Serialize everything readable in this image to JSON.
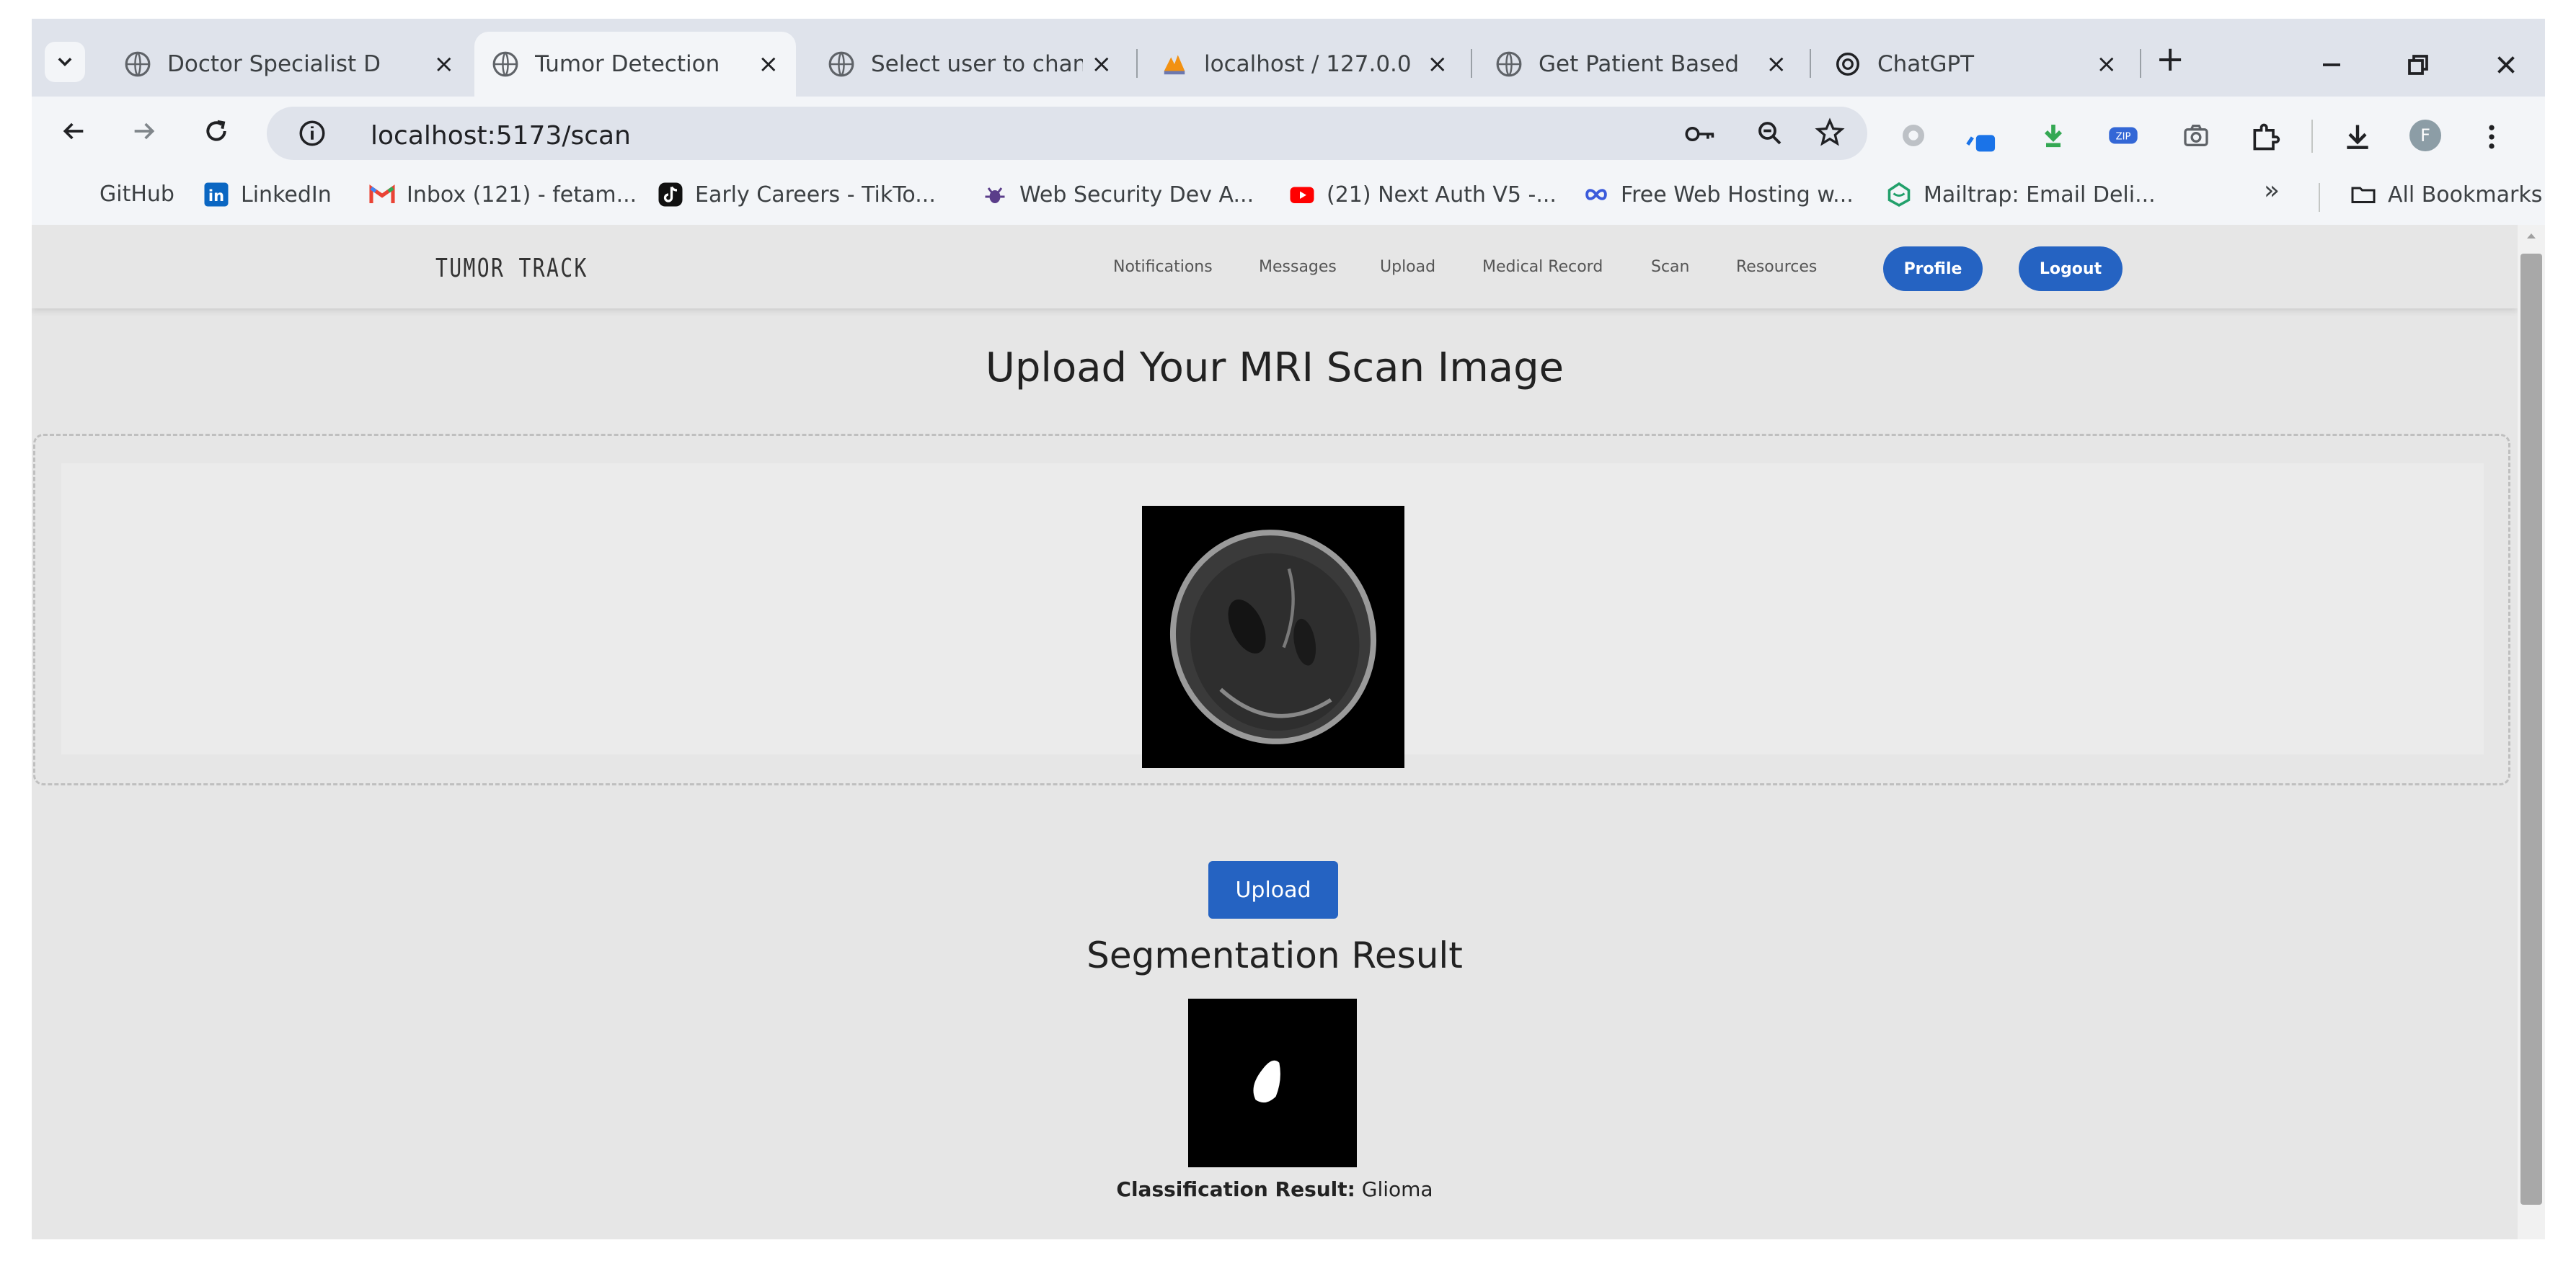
{
  "browser": {
    "tabs": [
      {
        "title": "Doctor Specialist D",
        "active": false
      },
      {
        "title": "Tumor Detection",
        "active": true
      },
      {
        "title": "Select user to chan",
        "active": false
      },
      {
        "title": "localhost / 127.0.0",
        "active": false
      },
      {
        "title": "Get Patient Based",
        "active": false
      },
      {
        "title": "ChatGPT",
        "active": false
      }
    ],
    "close_glyph": "×",
    "new_tab_glyph": "+",
    "url": "localhost:5173/scan",
    "bookmarks": [
      {
        "label": "GitHub",
        "icon": "github-icon"
      },
      {
        "label": "LinkedIn",
        "icon": "linkedin-icon"
      },
      {
        "label": "Inbox (121) - fetam...",
        "icon": "gmail-icon"
      },
      {
        "label": "Early Careers - TikTo...",
        "icon": "tiktok-icon"
      },
      {
        "label": "Web Security Dev A...",
        "icon": "bug-icon"
      },
      {
        "label": "(21) Next Auth V5 -...",
        "icon": "youtube-icon"
      },
      {
        "label": "Free Web Hosting w...",
        "icon": "infinity-icon"
      },
      {
        "label": "Mailtrap: Email Deli...",
        "icon": "mailtrap-icon"
      }
    ],
    "bookmarks_overflow": "»",
    "all_bookmarks": "All Bookmarks",
    "profile_initial": "F"
  },
  "app": {
    "brand": "TUMOR TRACK",
    "nav": [
      "Notifications",
      "Messages",
      "Upload",
      "Medical Record",
      "Scan",
      "Resources"
    ],
    "profile_button": "Profile",
    "logout_button": "Logout",
    "heading": "Upload Your MRI Scan Image",
    "upload_button": "Upload",
    "segmentation_heading": "Segmentation Result",
    "classification_label": "Classification Result:",
    "classification_value": "Glioma"
  },
  "colors": {
    "accent": "#2563c2",
    "page_bg": "#e6e6e6",
    "chrome_bg": "#dfe3eb"
  }
}
